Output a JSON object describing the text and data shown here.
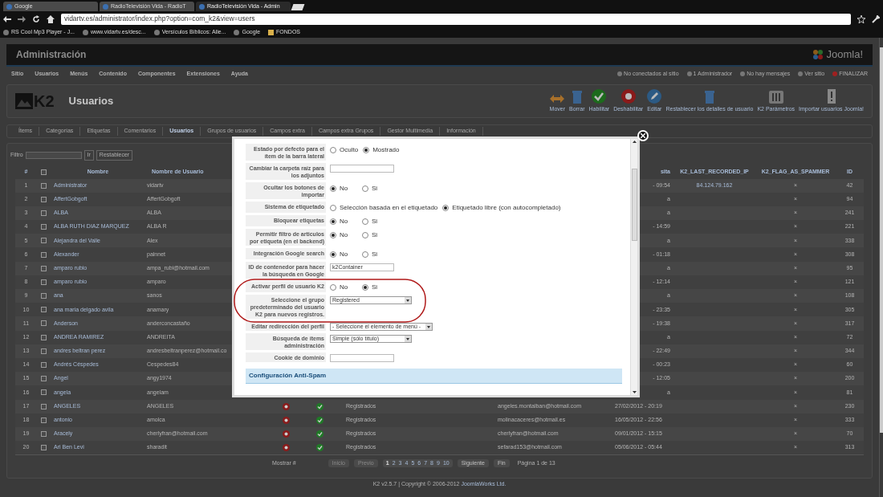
{
  "browser": {
    "tabs": [
      {
        "title": "Google",
        "selected": false
      },
      {
        "title": "RadioTelevisión Vida - RadioT",
        "selected": false
      },
      {
        "title": "RadioTelevisión Vida - Admin",
        "selected": true
      }
    ],
    "address": "vidartv.es/administrator/index.php?option=com_k2&view=users",
    "bookmarks": [
      "RS Cool Mp3 Player - J...",
      "www.vidartv.es/desc...",
      "Versículos Bíblicos: Alie...",
      "Google",
      "FONDOS"
    ]
  },
  "admin": {
    "title": "Administración",
    "logo_text": "Joomla!",
    "menu": [
      "Sitio",
      "Usuarios",
      "Menús",
      "Contenido",
      "Componentes",
      "Extensiones",
      "Ayuda"
    ],
    "status": [
      "No conectados al sitio",
      "1 Administrador",
      "No hay mensajes",
      "Ver sitio",
      "FINALIZAR"
    ]
  },
  "toolbar": {
    "logo_text": "K2",
    "title": "Usuarios",
    "buttons": [
      {
        "label": "Mover",
        "kind": "move"
      },
      {
        "label": "Borrar",
        "kind": "trash"
      },
      {
        "label": "Habilitar",
        "kind": "enable"
      },
      {
        "label": "Deshabilitar",
        "kind": "disable"
      },
      {
        "label": "Editar",
        "kind": "edit"
      },
      {
        "label": "Restablecer los detalles de usuario",
        "kind": "trash"
      },
      {
        "label": "K2 Parámetros",
        "kind": "params"
      },
      {
        "label": "Importar usuarios Joomla!",
        "kind": "import"
      }
    ]
  },
  "subtabs": [
    {
      "label": "Ítems",
      "selected": false
    },
    {
      "label": "Categorías",
      "selected": false
    },
    {
      "label": "Etiquetas",
      "selected": false
    },
    {
      "label": "Comentarios",
      "selected": false
    },
    {
      "label": "Usuarios",
      "selected": true
    },
    {
      "label": "Grupos de usuarios",
      "selected": false
    },
    {
      "label": "Campos extra",
      "selected": false
    },
    {
      "label": "Campos extra Grupos",
      "selected": false
    },
    {
      "label": "Gestor Multimedia",
      "selected": false
    },
    {
      "label": "Información",
      "selected": false
    }
  ],
  "filter": {
    "label": "Filtro",
    "go": "Ir",
    "reset": "Restablecer"
  },
  "table": {
    "select_all_checked": false,
    "columns": [
      "#",
      "Nombre",
      "Nombre de Usuario",
      "sita",
      "K2_LAST_RECORDED_IP",
      "K2_FLAG_AS_SPAMMER",
      "ID"
    ],
    "rows": [
      {
        "kind": "partial",
        "num": "1",
        "checked": false,
        "name": "Administrator",
        "username": "vidartv",
        "visit": "- 09:54",
        "ip": "84.124.79.162",
        "flag": "×",
        "id": "42"
      },
      {
        "kind": "partial",
        "num": "2",
        "checked": false,
        "name": "AffertGobgoft",
        "username": "AffertGobgoft",
        "visit": "a",
        "flag": "×",
        "id": "94"
      },
      {
        "kind": "partial",
        "num": "3",
        "checked": false,
        "name": "ALBA",
        "username": "ALBA",
        "visit": "a",
        "flag": "×",
        "id": "241"
      },
      {
        "kind": "partial",
        "num": "4",
        "checked": false,
        "name": "ALBA RUTH DIAZ MARQUEZ",
        "username": "ALBA R",
        "visit": "- 14:59",
        "flag": "×",
        "id": "221"
      },
      {
        "kind": "partial",
        "num": "5",
        "checked": false,
        "name": "Alejandra del Valle",
        "username": "Alex",
        "visit": "a",
        "flag": "×",
        "id": "338"
      },
      {
        "kind": "partial",
        "num": "6",
        "checked": false,
        "name": "Alexander",
        "username": "palnnet",
        "visit": "- 01:18",
        "flag": "×",
        "id": "308"
      },
      {
        "kind": "partial",
        "num": "7",
        "checked": false,
        "name": "amparo rubio",
        "username": "ampa_rubi@hotmail.com",
        "visit": "a",
        "flag": "×",
        "id": "95"
      },
      {
        "kind": "partial",
        "num": "8",
        "checked": false,
        "name": "amparo rubio",
        "username": "amparo",
        "visit": "- 12:14",
        "flag": "×",
        "id": "121"
      },
      {
        "kind": "partial",
        "num": "9",
        "checked": false,
        "name": "ana",
        "username": "sanos",
        "visit": "a",
        "flag": "×",
        "id": "108"
      },
      {
        "kind": "partial",
        "num": "10",
        "checked": false,
        "name": "ana maria delgado avila",
        "username": "anamary",
        "visit": "- 23:35",
        "flag": "×",
        "id": "305"
      },
      {
        "kind": "partial",
        "num": "11",
        "checked": false,
        "name": "Anderson",
        "username": "anderconcastaño",
        "visit": "- 19:38",
        "flag": "×",
        "id": "317"
      },
      {
        "kind": "partial",
        "num": "12",
        "checked": false,
        "name": "ANDREA RAMIREZ",
        "username": "ANDREITA",
        "visit": "a",
        "flag": "×",
        "id": "72"
      },
      {
        "kind": "partial",
        "num": "13",
        "checked": false,
        "name": "andres beltran perez",
        "username": "andresbeltranperez@hotmail.co",
        "visit": "- 22:49",
        "flag": "×",
        "id": "344"
      },
      {
        "kind": "partial",
        "num": "14",
        "checked": false,
        "name": "Andrés Céspedes",
        "username": "Cespedes84",
        "visit": "- 00:23",
        "flag": "×",
        "id": "60"
      },
      {
        "kind": "partial",
        "num": "15",
        "checked": false,
        "name": "Angel",
        "username": "angy1974",
        "visit": "- 12:05",
        "flag": "×",
        "id": "200"
      },
      {
        "kind": "partial",
        "num": "16",
        "checked": false,
        "name": "angela",
        "username": "angelam",
        "visit": "a",
        "flag": "×",
        "id": "81"
      },
      {
        "kind": "full",
        "num": "17",
        "checked": false,
        "name": "ANGELES",
        "username": "ANGELES",
        "online": false,
        "enabled": true,
        "group": "Registrados",
        "email": "angeles.montalban@hotmail.com",
        "visit": "27/02/2012 - 20:19",
        "flag": "×",
        "id": "230"
      },
      {
        "kind": "full",
        "num": "18",
        "checked": false,
        "name": "antonio",
        "username": "amolca",
        "online": false,
        "enabled": true,
        "group": "Registrados",
        "email": "molinacaceres@hotmail.es",
        "visit": "16/05/2012 - 22:56",
        "flag": "×",
        "id": "333"
      },
      {
        "kind": "full",
        "num": "19",
        "checked": false,
        "name": "Aracely",
        "username": "cherlyfran@hotmail.com",
        "online": false,
        "enabled": true,
        "group": "Registrados",
        "email": "cherlyfran@hotmail.com",
        "visit": "09/01/2012 - 15:15",
        "flag": "×",
        "id": "70"
      },
      {
        "kind": "full",
        "num": "20",
        "checked": false,
        "name": "Ari Ben Levi",
        "username": "sharadit",
        "online": false,
        "enabled": true,
        "group": "Registrados",
        "email": "sefarad153@hotmail.com",
        "visit": "05/06/2012 - 05:44",
        "flag": "×",
        "id": "313"
      }
    ]
  },
  "pagination": {
    "show": "Mostrar #",
    "start": {
      "label": "Inicio",
      "disabled": true
    },
    "prev": {
      "label": "Previo",
      "disabled": true
    },
    "pages": [
      {
        "label": "1",
        "selected": true
      },
      {
        "label": "2",
        "selected": false
      },
      {
        "label": "3",
        "selected": false
      },
      {
        "label": "4",
        "selected": false
      },
      {
        "label": "5",
        "selected": false
      },
      {
        "label": "6",
        "selected": false
      },
      {
        "label": "7",
        "selected": false
      },
      {
        "label": "8",
        "selected": false
      },
      {
        "label": "9",
        "selected": false
      },
      {
        "label": "10",
        "selected": false
      }
    ],
    "next": {
      "label": "Siguiente",
      "disabled": false
    },
    "end": {
      "label": "Fin",
      "disabled": false
    },
    "page_info": "Página 1 de 13"
  },
  "footer": {
    "text": "K2 v2.5.7 | Copyright © 2006-2012",
    "link": "JoomlaWorks Ltd."
  },
  "modal": {
    "fields": [
      {
        "label": "Estado por defecto para el ítem de la barra lateral",
        "kind": "radio",
        "options": [
          {
            "label": "Oculto",
            "selected": false
          },
          {
            "label": "Mostrado",
            "selected": true
          }
        ]
      },
      {
        "label": "Cambiar la carpeta raíz para los adjuntos",
        "kind": "text"
      },
      {
        "label": "Ocultar los botones de importar",
        "kind": "radio",
        "options": [
          {
            "label": "No",
            "selected": true
          },
          {
            "label": "Si",
            "selected": false
          }
        ]
      },
      {
        "label": "Sistema de etiquetado",
        "kind": "radio",
        "options": [
          {
            "label": "Selección basada en el etiquetado",
            "selected": false
          },
          {
            "label": "Etiquetado libre (con autocompletado)",
            "selected": true
          }
        ]
      },
      {
        "label": "Bloquear etiquetas",
        "kind": "radio",
        "options": [
          {
            "label": "No",
            "selected": true
          },
          {
            "label": "Si",
            "selected": false
          }
        ]
      },
      {
        "label": "Permitir filtro de articulos por etiqueta (en el backend)",
        "kind": "radio",
        "options": [
          {
            "label": "No",
            "selected": true
          },
          {
            "label": "Si",
            "selected": false
          }
        ]
      },
      {
        "label": "Integración Google search",
        "kind": "radio",
        "options": [
          {
            "label": "No",
            "selected": true
          },
          {
            "label": "Si",
            "selected": false
          }
        ]
      },
      {
        "label": "ID de contenedor para hacer la búsqueda en Google",
        "kind": "text",
        "value": "k2Container"
      },
      {
        "label": "Activar perfil de usuario K2",
        "kind": "radio",
        "options": [
          {
            "label": "No",
            "selected": false
          },
          {
            "label": "Si",
            "selected": true
          }
        ]
      },
      {
        "label": "Seleccione el grupo predeterminado del usuario K2 para nuevos registros.",
        "kind": "select",
        "value": "Registered"
      },
      {
        "label": "Editar redirección del perfil",
        "kind": "select",
        "value": "- Seleccione el elemento de menú -"
      },
      {
        "label": "Búsqueda de ítems administración",
        "kind": "select",
        "value": "Simple (sólo título)"
      },
      {
        "label": "Cookie de dominio",
        "kind": "text"
      }
    ],
    "section": "Configuración Anti-Spam"
  }
}
